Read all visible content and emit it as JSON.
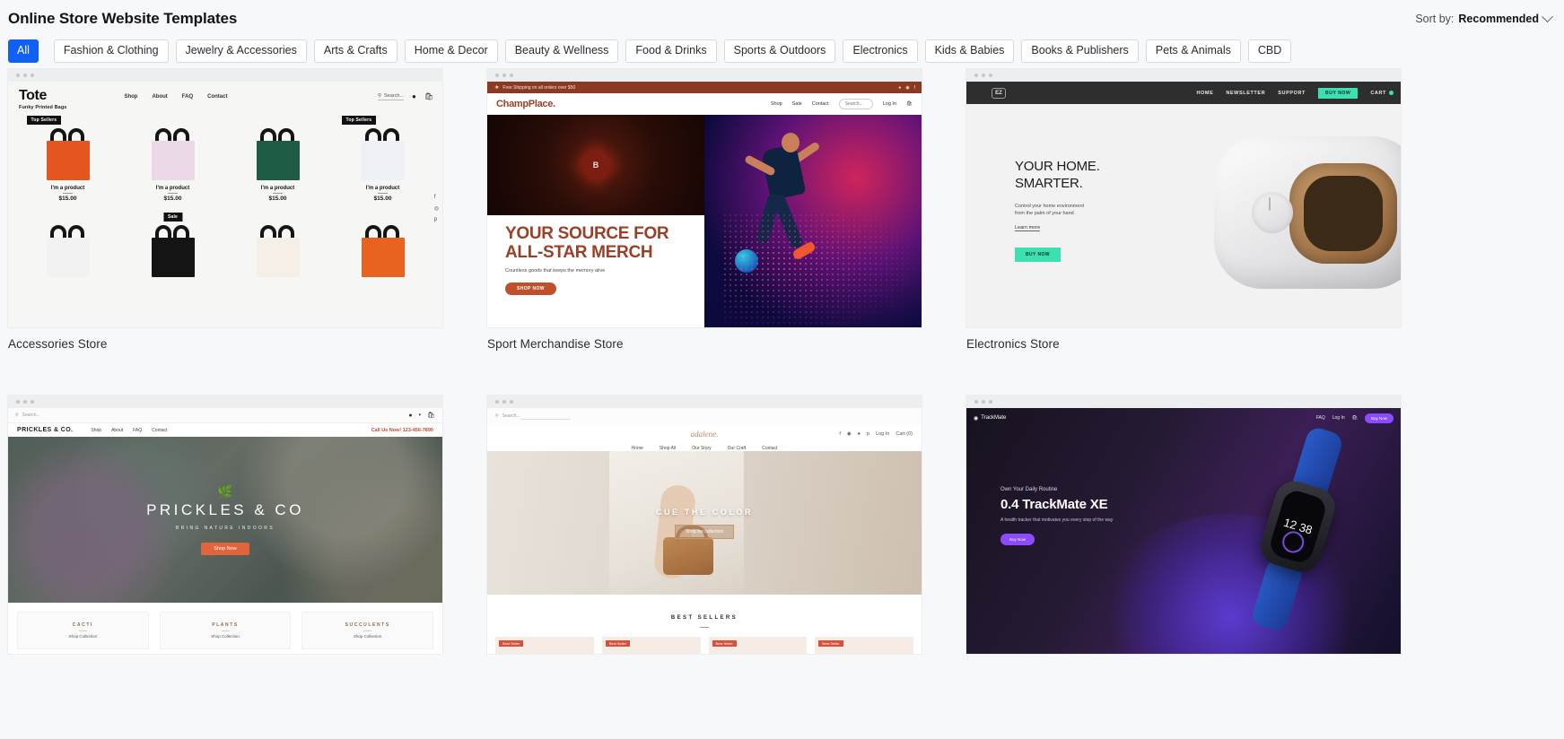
{
  "header": {
    "title": "Online Store Website Templates",
    "sort_label": "Sort by:",
    "sort_value": "Recommended",
    "chevron_icon": "chevron-down-icon"
  },
  "filters": {
    "active": "All",
    "chips": [
      "All",
      "Fashion & Clothing",
      "Jewelry & Accessories",
      "Arts & Crafts",
      "Home & Decor",
      "Beauty & Wellness",
      "Food & Drinks",
      "Sports & Outdoors",
      "Electronics",
      "Kids & Babies",
      "Books & Publishers",
      "Pets & Animals",
      "CBD"
    ]
  },
  "templates": [
    {
      "label": "Accessories Store",
      "site": {
        "brand": "Tote",
        "tagline": "Funky Printed Bags",
        "nav": [
          "Shop",
          "About",
          "FAQ",
          "Contact"
        ],
        "search_placeholder": "Search...",
        "badges": {
          "top_sellers": "Top Sellers",
          "sale": "Sale"
        },
        "products": [
          {
            "name": "I'm a product",
            "price": "$15.00"
          },
          {
            "name": "I'm a product",
            "price": "$15.00"
          },
          {
            "name": "I'm a product",
            "price": "$15.00"
          },
          {
            "name": "I'm a product",
            "price": "$15.00"
          }
        ],
        "social": [
          "f",
          "◎",
          "p"
        ]
      }
    },
    {
      "label": "Sport Merchandise Store",
      "site": {
        "announcement": "Free Shipping on all orders over $50",
        "brand": "ChampPlace.",
        "nav": [
          "Shop",
          "Sale",
          "Contact"
        ],
        "search_placeholder": "Search...",
        "login": "Log In",
        "headline": "YOUR SOURCE FOR ALL-STAR MERCH",
        "subline": "Countless goods that keeps the memory alive",
        "cta": "SHOP NOW"
      }
    },
    {
      "label": "Electronics Store",
      "site": {
        "logo": "EZ",
        "nav": [
          "HOME",
          "NEWSLETTER",
          "SUPPORT"
        ],
        "buy_button": "BUY NOW",
        "cart": "CART",
        "headline_line1": "YOUR HOME.",
        "headline_line2": "SMARTER.",
        "paragraph_line1": "Control your home environment",
        "paragraph_line2": "from the palm of your hand",
        "learn_more": "Learn more",
        "cta": "BUY NOW"
      }
    },
    {
      "label": "",
      "site": {
        "search_placeholder": "Search...",
        "brand": "PRICKLES & CO.",
        "nav": [
          "Shop",
          "About",
          "FAQ",
          "Contact"
        ],
        "phone": "Call Us Now! 123-456-7890",
        "headline": "PRICKLES & CO",
        "subline": "BRING NATURE INDOORS",
        "cta": "Shop Now",
        "categories": [
          {
            "title": "CACTI",
            "link": "Shop Collection"
          },
          {
            "title": "PLANTS",
            "link": "Shop Collection"
          },
          {
            "title": "SUCCULENTS",
            "link": "Shop Collection"
          }
        ]
      }
    },
    {
      "label": "",
      "site": {
        "search_placeholder": "Search...",
        "brand": "adalene.",
        "nav": [
          "Home",
          "Shop All",
          "Our Story",
          "Our Craft",
          "Contact"
        ],
        "login": "Log In",
        "cart": "Cart (0)",
        "headline": "CUE THE COLOR",
        "cta": "Shop the collection",
        "section_title": "BEST SELLERS",
        "tiles": [
          {
            "badge": "Best Seller"
          },
          {
            "badge": "Best Seller"
          },
          {
            "badge": "Best Seller"
          },
          {
            "badge": "Best Seller"
          }
        ]
      }
    },
    {
      "label": "",
      "site": {
        "brand": "TrackMate",
        "nav": [
          "FAQ"
        ],
        "login": "Log In",
        "buy_button": "Buy Now",
        "kicker": "Own Your Daily Routine",
        "headline": "0.4 TrackMate XE",
        "paragraph": "A health tracker that motivates you every step of the way",
        "cta": "Buy Now",
        "watch_time": "12 38"
      }
    }
  ]
}
